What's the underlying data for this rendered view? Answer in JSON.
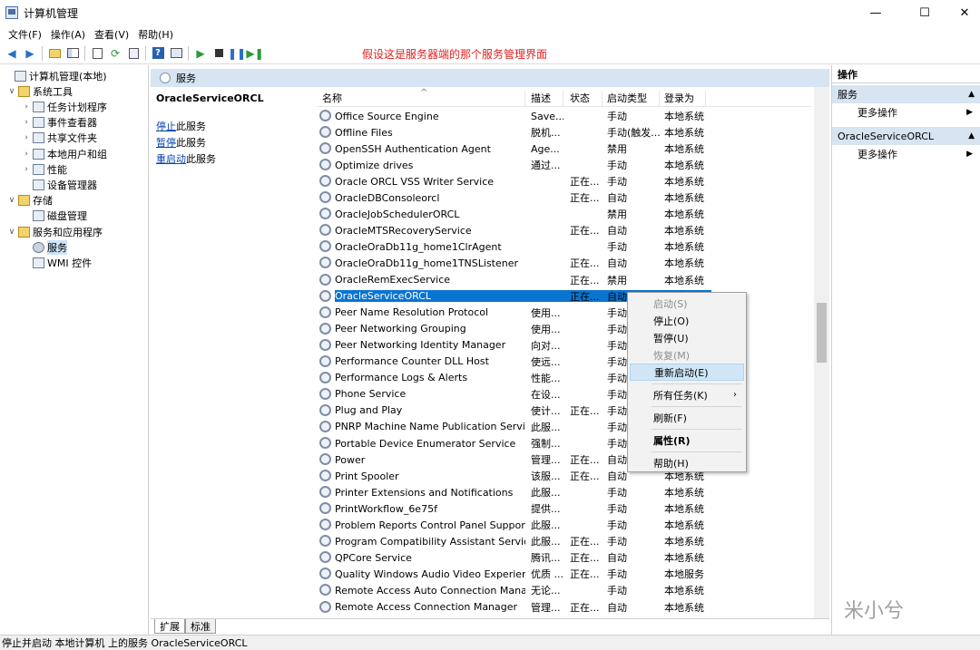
{
  "window": {
    "title": "计算机管理",
    "min": "—",
    "max": "☐",
    "close": "✕"
  },
  "menu": [
    "文件(F)",
    "操作(A)",
    "查看(V)",
    "帮助(H)"
  ],
  "annotation": "假设这是服务器端的那个服务管理界面",
  "tree": [
    {
      "label": "计算机管理(本地)",
      "level": 0,
      "tw": ""
    },
    {
      "label": "系统工具",
      "level": 1,
      "tw": "∨"
    },
    {
      "label": "任务计划程序",
      "level": 2,
      "tw": "›"
    },
    {
      "label": "事件查看器",
      "level": 2,
      "tw": "›"
    },
    {
      "label": "共享文件夹",
      "level": 2,
      "tw": "›"
    },
    {
      "label": "本地用户和组",
      "level": 2,
      "tw": "›"
    },
    {
      "label": "性能",
      "level": 2,
      "tw": "›"
    },
    {
      "label": "设备管理器",
      "level": 2,
      "tw": ""
    },
    {
      "label": "存储",
      "level": 1,
      "tw": "∨"
    },
    {
      "label": "磁盘管理",
      "level": 2,
      "tw": ""
    },
    {
      "label": "服务和应用程序",
      "level": 1,
      "tw": "∨"
    },
    {
      "label": "服务",
      "level": 2,
      "tw": "",
      "selected": true
    },
    {
      "label": "WMI 控件",
      "level": 2,
      "tw": ""
    }
  ],
  "middle": {
    "header": "服务",
    "service_name": "OracleServiceORCL",
    "actions": [
      {
        "link": "停止",
        "rest": "此服务"
      },
      {
        "link": "暂停",
        "rest": "此服务"
      },
      {
        "link": "重启动",
        "rest": "此服务"
      }
    ],
    "columns": [
      "名称",
      "描述",
      "状态",
      "启动类型",
      "登录为"
    ],
    "sort_indicator": "^",
    "rows": [
      [
        "Office  Source Engine",
        "Save...",
        "",
        "手动",
        "本地系统"
      ],
      [
        "Offline Files",
        "脱机...",
        "",
        "手动(触发...",
        "本地系统"
      ],
      [
        "OpenSSH Authentication Agent",
        "Age...",
        "",
        "禁用",
        "本地系统"
      ],
      [
        "Optimize drives",
        "通过...",
        "",
        "手动",
        "本地系统"
      ],
      [
        "Oracle ORCL VSS Writer Service",
        "",
        "正在...",
        "手动",
        "本地系统"
      ],
      [
        "OracleDBConsoleorcl",
        "",
        "正在...",
        "自动",
        "本地系统"
      ],
      [
        "OracleJobSchedulerORCL",
        "",
        "",
        "禁用",
        "本地系统"
      ],
      [
        "OracleMTSRecoveryService",
        "",
        "正在...",
        "自动",
        "本地系统"
      ],
      [
        "OracleOraDb11g_home1ClrAgent",
        "",
        "",
        "手动",
        "本地系统"
      ],
      [
        "OracleOraDb11g_home1TNSListener",
        "",
        "正在...",
        "自动",
        "本地系统"
      ],
      [
        "OracleRemExecService",
        "",
        "正在...",
        "禁用",
        "本地系统"
      ],
      [
        "OracleServiceORCL",
        "",
        "正在...",
        "自动",
        "本地系统"
      ],
      [
        "Peer Name Resolution Protocol",
        "使用...",
        "",
        "手动",
        "本地系统"
      ],
      [
        "Peer Networking Grouping",
        "使用...",
        "",
        "手动",
        "本地系统"
      ],
      [
        "Peer Networking Identity Manager",
        "向对...",
        "",
        "手动",
        "本地系统"
      ],
      [
        "Performance Counter DLL Host",
        "使远...",
        "",
        "手动",
        "本地系统"
      ],
      [
        "Performance Logs & Alerts",
        "性能...",
        "",
        "手动",
        "本地系统"
      ],
      [
        "Phone Service",
        "在设...",
        "",
        "手动",
        "本地系统"
      ],
      [
        "Plug and Play",
        "使计...",
        "正在...",
        "手动",
        "本地系统"
      ],
      [
        "PNRP Machine Name Publication Service",
        "此服...",
        "",
        "手动",
        "本地系统"
      ],
      [
        "Portable Device Enumerator Service",
        "强制...",
        "",
        "手动",
        "本地系统"
      ],
      [
        "Power",
        "管理...",
        "正在...",
        "自动",
        "本地系统"
      ],
      [
        "Print Spooler",
        "该服...",
        "正在...",
        "自动",
        "本地系统"
      ],
      [
        "Printer Extensions and Notifications",
        "此服...",
        "",
        "手动",
        "本地系统"
      ],
      [
        "PrintWorkflow_6e75f",
        "提供...",
        "",
        "手动",
        "本地系统"
      ],
      [
        "Problem Reports Control Panel Support",
        "此服...",
        "",
        "手动",
        "本地系统"
      ],
      [
        "Program Compatibility Assistant Service",
        "此服...",
        "正在...",
        "手动",
        "本地系统"
      ],
      [
        "QPCore Service",
        "腾讯...",
        "正在...",
        "自动",
        "本地系统"
      ],
      [
        "Quality Windows Audio Video Experience",
        "优质 ...",
        "正在...",
        "手动",
        "本地服务"
      ],
      [
        "Remote Access Auto Connection Manag...",
        "无论...",
        "",
        "手动",
        "本地系统"
      ],
      [
        "Remote Access Connection Manager",
        "管理...",
        "正在...",
        "自动",
        "本地系统"
      ]
    ],
    "selected_index": 11,
    "tabs": [
      "扩展",
      "标准"
    ]
  },
  "context_menu": {
    "start": "启动(S)",
    "stop": "停止(O)",
    "pause": "暂停(U)",
    "resume": "恢复(M)",
    "restart": "重新启动(E)",
    "all_tasks": "所有任务(K)",
    "refresh": "刷新(F)",
    "properties": "属性(R)",
    "help": "帮助(H)"
  },
  "right": {
    "title": "操作",
    "section1": "服务",
    "more1": "更多操作",
    "section2": "OracleServiceORCL",
    "more2": "更多操作"
  },
  "status": "停止并启动 本地计算机 上的服务 OracleServiceORCL",
  "watermark": "米小兮"
}
